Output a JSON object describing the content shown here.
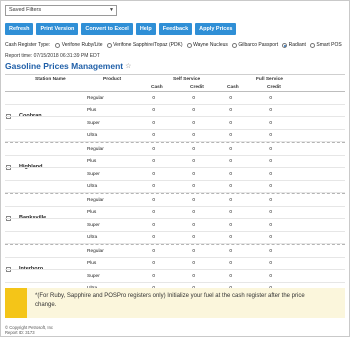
{
  "filter": {
    "value": "Saved Filters"
  },
  "toolbar": [
    "Refresh",
    "Print Version",
    "Convert to Excel",
    "Help",
    "Feedback",
    "Apply Prices"
  ],
  "register": {
    "label": "Cash Register Type:",
    "options": [
      {
        "label": "Verifone Ruby/Lite",
        "selected": false
      },
      {
        "label": "Verifone Sapphire/Topaz (PDK)",
        "selected": false
      },
      {
        "label": "Wayne Nucleus",
        "selected": false
      },
      {
        "label": "Gilbarco Passport",
        "selected": false
      },
      {
        "label": "Radiant",
        "selected": true
      },
      {
        "label": "Smart POS",
        "selected": false
      }
    ]
  },
  "report_time": "Report time: 07/15/2018 06:31:39 PM EDT",
  "title": "Gasoline Prices Management",
  "headers": {
    "station": "Station Name",
    "product": "Product",
    "self": "Self Service",
    "full": "Full Service",
    "cash": "Cash",
    "credit": "Credit"
  },
  "stations": [
    {
      "name": "Coobran",
      "rows": [
        {
          "product": "Regular",
          "v": [
            "0",
            "0",
            "0",
            "0"
          ]
        },
        {
          "product": "Plus",
          "v": [
            "0",
            "0",
            "0",
            "0"
          ]
        },
        {
          "product": "Super",
          "v": [
            "0",
            "0",
            "0",
            "0"
          ]
        },
        {
          "product": "Ultra",
          "v": [
            "0",
            "0",
            "0",
            "0"
          ]
        }
      ]
    },
    {
      "name": "Highland",
      "rows": [
        {
          "product": "Regular",
          "v": [
            "0",
            "0",
            "0",
            "0"
          ]
        },
        {
          "product": "Plus",
          "v": [
            "0",
            "0",
            "0",
            "0"
          ]
        },
        {
          "product": "Super",
          "v": [
            "0",
            "0",
            "0",
            "0"
          ]
        },
        {
          "product": "Ultra",
          "v": [
            "0",
            "0",
            "0",
            "0"
          ]
        }
      ]
    },
    {
      "name": "Banksville",
      "rows": [
        {
          "product": "Regular",
          "v": [
            "0",
            "0",
            "0",
            "0"
          ]
        },
        {
          "product": "Plus",
          "v": [
            "0",
            "0",
            "0",
            "0"
          ]
        },
        {
          "product": "Super",
          "v": [
            "0",
            "0",
            "0",
            "0"
          ]
        },
        {
          "product": "Ultra",
          "v": [
            "0",
            "0",
            "0",
            "0"
          ]
        }
      ]
    },
    {
      "name": "Interboro",
      "rows": [
        {
          "product": "Regular",
          "v": [
            "0",
            "0",
            "0",
            "0"
          ]
        },
        {
          "product": "Plus",
          "v": [
            "0",
            "0",
            "0",
            "0"
          ]
        },
        {
          "product": "Super",
          "v": [
            "0",
            "0",
            "0",
            "0"
          ]
        },
        {
          "product": "Ultra",
          "v": [
            "0",
            "0",
            "0",
            "0"
          ]
        }
      ]
    }
  ],
  "note": "*(For Ruby, Sapphire and POSPro registers only) Initialize your fuel at the cash register after the price change.",
  "footer": {
    "copyright": "© Copyright Petrosoft, Inc",
    "report_id": "Report ID: 3173"
  },
  "colors": {
    "button": "#2f8fd6",
    "title": "#1f5fa8",
    "note_bar": "#f4c518",
    "note_bg": "#fbf6dc"
  }
}
